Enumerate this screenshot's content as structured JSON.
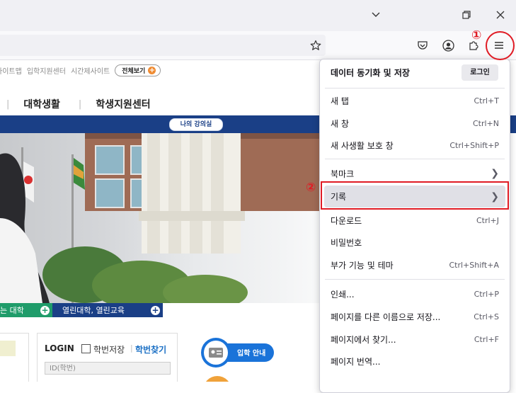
{
  "window": {
    "controls": [
      "chevron-down-icon",
      "restore-icon",
      "close-icon"
    ]
  },
  "toolbar": {
    "icons": [
      "bookmark-star-icon",
      "pocket-icon",
      "account-icon",
      "extensions-icon",
      "hamburger-menu-icon"
    ]
  },
  "page": {
    "utility_links": [
      "사이트맵",
      "입학지원센터",
      "시간제사이트"
    ],
    "all_view": "전체보기",
    "nav": [
      "대학생활",
      "학생지원센터"
    ],
    "my_lecture": "나의 강의실",
    "promo_left": "는 대학",
    "promo_right": "열린대학, 열린교육",
    "login": {
      "title": "LOGIN",
      "save_id": "학번저장",
      "find_id": "학번찾기",
      "id_placeholder": "ID(학번)"
    },
    "admission": "입학 안내"
  },
  "menu": {
    "header_title": "데이터 동기화 및 저장",
    "login_button": "로그인",
    "items": [
      {
        "label": "새 탭",
        "shortcut": "Ctrl+T"
      },
      {
        "label": "새 창",
        "shortcut": "Ctrl+N"
      },
      {
        "label": "새 사생활 보호 창",
        "shortcut": "Ctrl+Shift+P"
      },
      {
        "label": "북마크",
        "shortcut": ""
      },
      {
        "label": "기록",
        "shortcut": ""
      },
      {
        "label": "다운로드",
        "shortcut": "Ctrl+J"
      },
      {
        "label": "비밀번호",
        "shortcut": ""
      },
      {
        "label": "부가 기능 및 테마",
        "shortcut": "Ctrl+Shift+A"
      },
      {
        "label": "인쇄...",
        "shortcut": "Ctrl+P"
      },
      {
        "label": "페이지를 다른 이름으로 저장...",
        "shortcut": "Ctrl+S"
      },
      {
        "label": "페이지에서 찾기...",
        "shortcut": "Ctrl+F"
      },
      {
        "label": "페이지 번역...",
        "shortcut": ""
      }
    ],
    "hovered_item": "기록"
  },
  "annotations": {
    "step1": "①",
    "step2": "②"
  },
  "colors": {
    "annotation": "#e01b24",
    "site_blue": "#1a3f86",
    "site_green": "#1f9c6a",
    "menu_hover": "#e0e0e6"
  }
}
